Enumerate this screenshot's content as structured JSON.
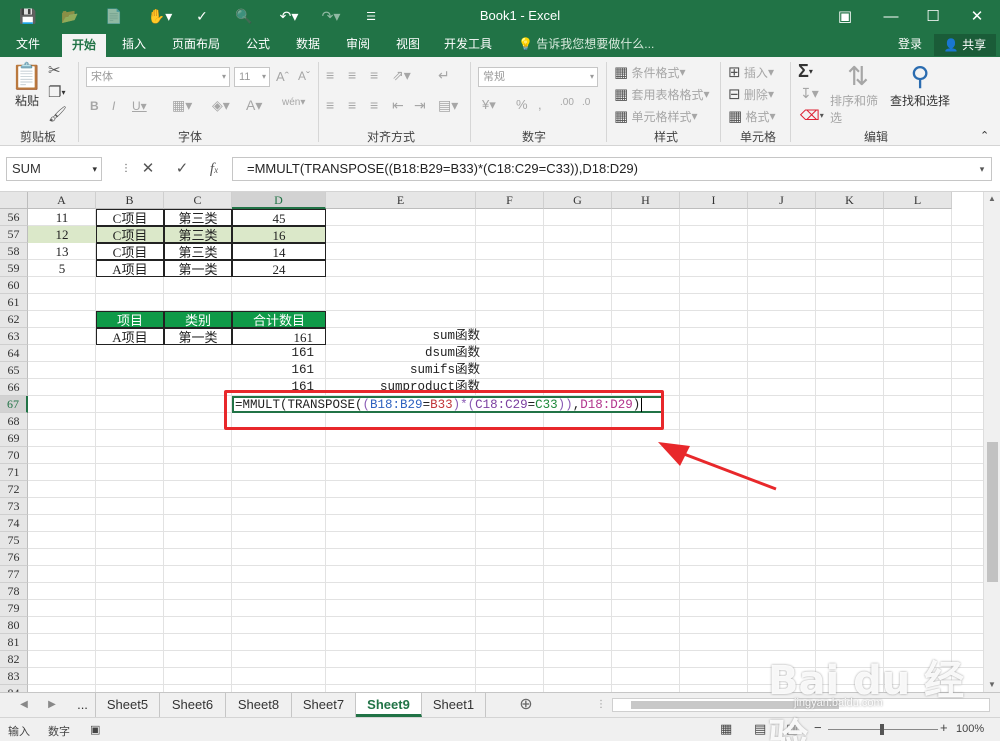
{
  "window": {
    "title": "Book1 - Excel"
  },
  "ribbon_tabs": [
    "文件",
    "开始",
    "插入",
    "页面布局",
    "公式",
    "数据",
    "审阅",
    "视图",
    "开发工具"
  ],
  "active_tab": "开始",
  "tell_me": "告诉我您想要做什么...",
  "account": {
    "login": "登录",
    "share": "共享"
  },
  "groups": {
    "clipboard": {
      "label": "剪贴板",
      "paste": "粘贴"
    },
    "font": {
      "label": "字体",
      "name": "宋体",
      "size": "11"
    },
    "align": {
      "label": "对齐方式"
    },
    "number": {
      "label": "数字",
      "format": "常规"
    },
    "styles": {
      "label": "样式",
      "cond": "条件格式",
      "table": "套用表格格式",
      "cell": "单元格样式"
    },
    "cells": {
      "label": "单元格",
      "insert": "插入",
      "delete": "删除",
      "format": "格式"
    },
    "edit": {
      "label": "编辑",
      "sort": "排序和筛选",
      "find": "查找和选择"
    }
  },
  "formula_bar": {
    "name_box": "SUM",
    "formula": "=MMULT(TRANSPOSE((B18:B29=B33)*(C18:C29=C33)),D18:D29)"
  },
  "columns": [
    "A",
    "B",
    "C",
    "D",
    "E",
    "F",
    "G",
    "H",
    "I",
    "J",
    "K",
    "L"
  ],
  "rows": [
    "56",
    "57",
    "58",
    "59",
    "60",
    "61",
    "62",
    "63",
    "64",
    "65",
    "66",
    "67",
    "68",
    "69",
    "70",
    "71",
    "72",
    "73",
    "74",
    "75",
    "76",
    "77",
    "78",
    "79",
    "80",
    "81",
    "82",
    "83",
    "84"
  ],
  "data_rows": [
    {
      "a": "11",
      "b": "C项目",
      "c": "第三类",
      "d": "45"
    },
    {
      "a": "12",
      "b": "C项目",
      "c": "第三类",
      "d": "16"
    },
    {
      "a": "13",
      "b": "C项目",
      "c": "第三类",
      "d": "14"
    },
    {
      "a": "5",
      "b": "A项目",
      "c": "第一类",
      "d": "24"
    }
  ],
  "summary_header": [
    "项目",
    "类别",
    "合计数目"
  ],
  "summary_row": {
    "b": "A项目",
    "c": "第一类",
    "d": "161"
  },
  "results": [
    {
      "d": "161",
      "e": "sum函数"
    },
    {
      "d": "161",
      "e": "dsum函数"
    },
    {
      "d": "161",
      "e": "sumifs函数"
    },
    {
      "d": "161",
      "e": "sumproduct函数"
    }
  ],
  "edit_cell": {
    "p1": "=MMULT(TRANSPOSE(",
    "p2": "(",
    "p3": "B18:B29",
    "p4": "=",
    "p5": "B33",
    "p6": ")*",
    "p7": "(",
    "p8": "C18:C29",
    "p9": "=",
    "p10": "C33",
    "p11": "))",
    "p12": ",",
    "p13": "D18:D29",
    "p14": ")"
  },
  "sheet_tabs": [
    "...",
    "Sheet5",
    "Sheet6",
    "Sheet8",
    "Sheet7",
    "Sheet9",
    "Sheet1"
  ],
  "active_sheet": "Sheet9",
  "status": {
    "mode": "输入",
    "num": "数字",
    "zoom": "100%"
  },
  "watermark": {
    "brand": "Bai du 经验",
    "url": "jingyan.baidu.com"
  },
  "colors": {
    "accent": "#217346",
    "annotation": "#e8282b",
    "header_fill": "#0f9a48",
    "highlight": "#dbe8c9"
  }
}
